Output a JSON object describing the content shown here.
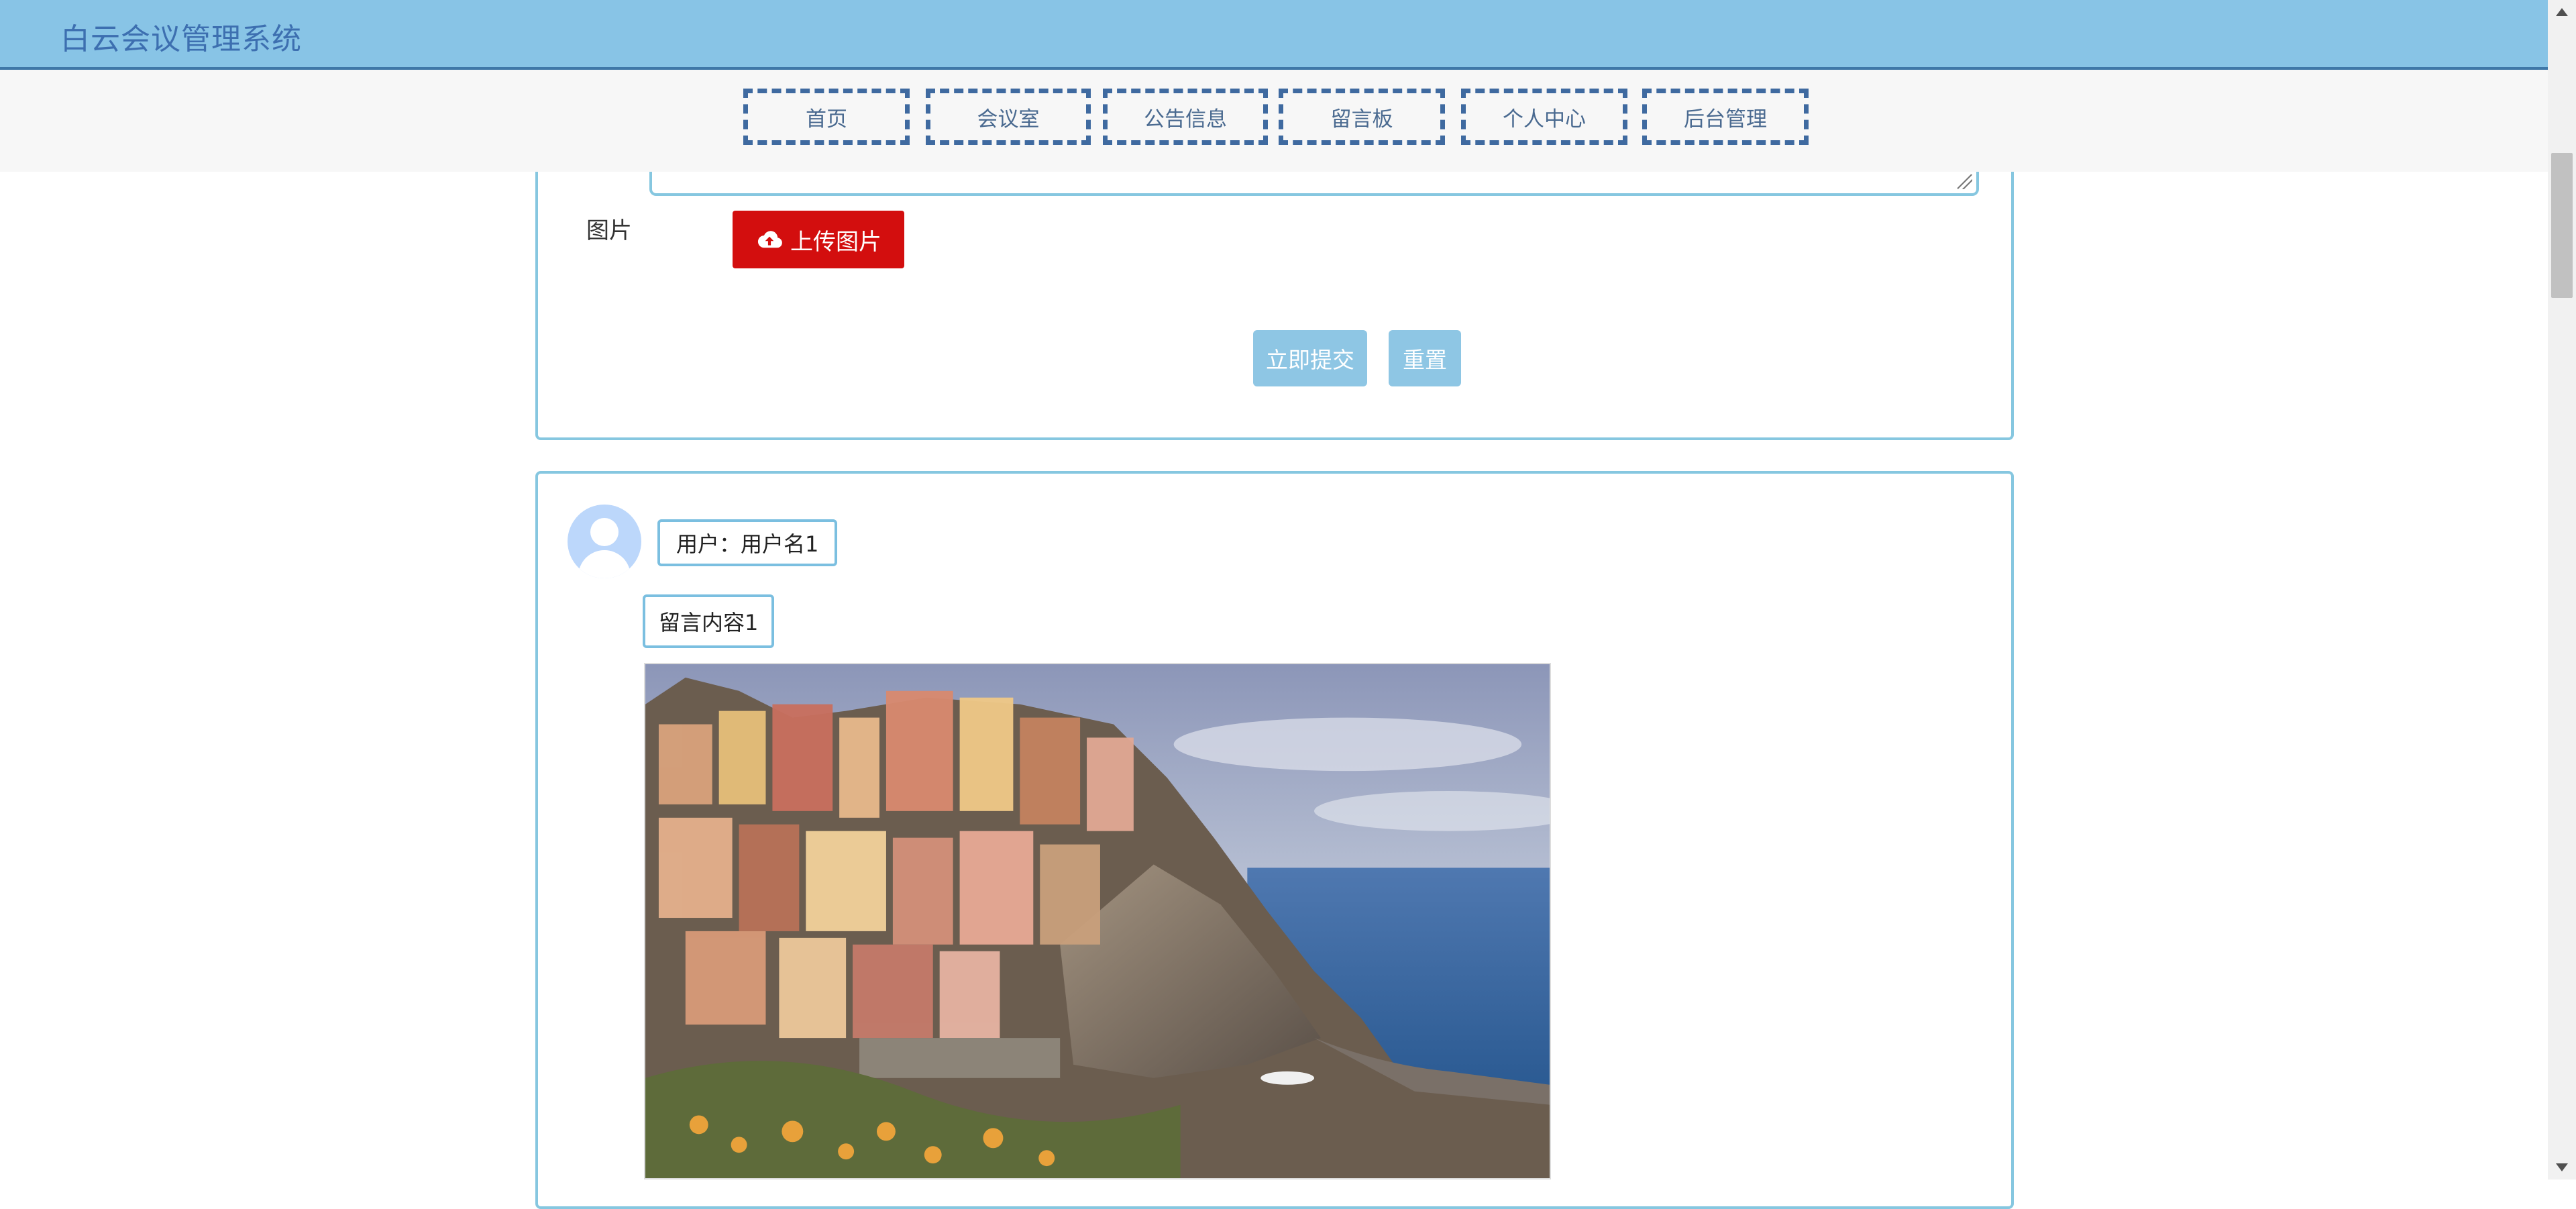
{
  "app": {
    "title": "白云会议管理系统"
  },
  "nav": {
    "items": [
      {
        "label": "首页"
      },
      {
        "label": "会议室"
      },
      {
        "label": "公告信息"
      },
      {
        "label": "留言板"
      },
      {
        "label": "个人中心"
      },
      {
        "label": "后台管理"
      }
    ]
  },
  "form": {
    "image_label": "图片",
    "upload_label": "上传图片",
    "upload_icon": "cloud-upload-icon",
    "submit_label": "立即提交",
    "reset_label": "重置"
  },
  "message": {
    "user_label": "用户：用户名1",
    "content": "留言内容1",
    "avatar_icon": "user-avatar-icon"
  },
  "colors": {
    "header_bg": "#88c4e6",
    "title_color": "#3d6fb0",
    "nav_border": "#3f6aa0",
    "upload_btn": "#d30e0e",
    "primary_btn": "#8ec6e4",
    "card_border": "#86c7e0"
  }
}
